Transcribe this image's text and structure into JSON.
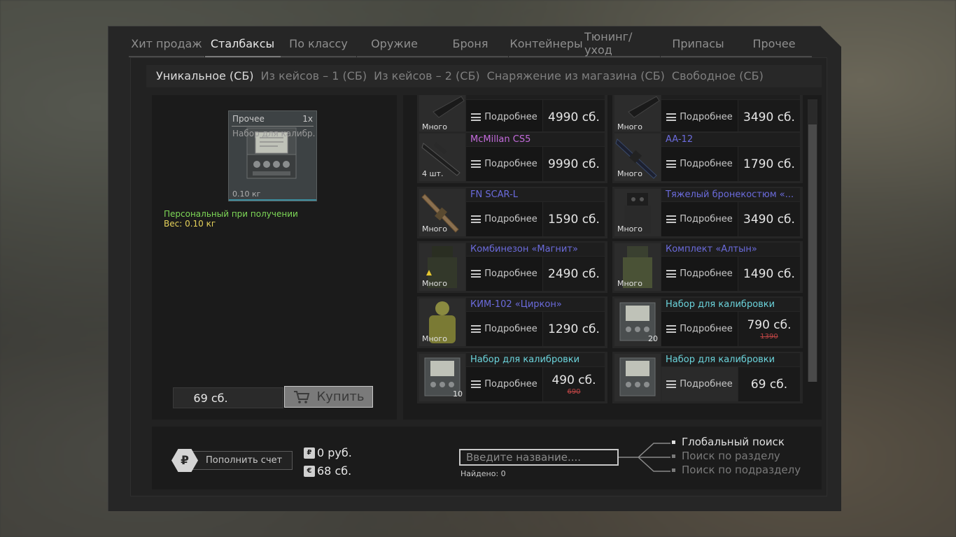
{
  "tabs": [
    "Хит продаж",
    "Сталбаксы",
    "По классу",
    "Оружие",
    "Броня",
    "Контейнеры",
    "Тюнинг/уход",
    "Припасы",
    "Прочее"
  ],
  "active_tab": 1,
  "subtabs": [
    "Уникальное (СБ)",
    "Из кейсов – 1 (СБ)",
    "Из кейсов – 2 (СБ)",
    "Снаряжение из магазина (СБ)",
    "Свободное (СБ)"
  ],
  "active_subtab": 0,
  "preview": {
    "category": "Прочее",
    "quantity": "1x",
    "name": "Набор для калибр...",
    "weight": "0.10 кг",
    "personal_text": "Персональный при получении",
    "weight_text": "Вес: 0.10 кг"
  },
  "purchase": {
    "price": "69 сб.",
    "buy_label": "Купить"
  },
  "details_label": "Подробнее",
  "items": [
    {
      "name": "",
      "color": "#9a6bdc",
      "badge": "Много",
      "price": "4990 сб.",
      "old_price": ""
    },
    {
      "name": "",
      "color": "#6b6bdc",
      "badge": "Много",
      "price": "3490 сб.",
      "old_price": ""
    },
    {
      "name": "McMillan CS5",
      "color": "#c46bdc",
      "badge": "4 шт.",
      "price": "9990 сб.",
      "old_price": ""
    },
    {
      "name": "AA-12",
      "color": "#6b6bdc",
      "badge": "Много",
      "price": "1790 сб.",
      "old_price": ""
    },
    {
      "name": "FN SCAR-L",
      "color": "#6b6bdc",
      "badge": "Много",
      "price": "1590 сб.",
      "old_price": ""
    },
    {
      "name": "Тяжелый бронекостюм «...",
      "color": "#6b6bdc",
      "badge": "Много",
      "price": "3490 сб.",
      "old_price": ""
    },
    {
      "name": "Комбинезон «Магнит»",
      "color": "#6b6bdc",
      "badge": "Много",
      "price": "2490 сб.",
      "old_price": ""
    },
    {
      "name": "Комплект «Алтын»",
      "color": "#6b6bdc",
      "badge": "Много",
      "price": "1490 сб.",
      "old_price": ""
    },
    {
      "name": "КИМ-102 «Циркон»",
      "color": "#6b6bdc",
      "badge": "Много",
      "price": "1290 сб.",
      "old_price": ""
    },
    {
      "name": "Набор для калибровки",
      "color": "#6bd4dc",
      "badge": "20",
      "price": "790 сб.",
      "old_price": "1390"
    },
    {
      "name": "Набор для калибровки",
      "color": "#6bd4dc",
      "badge": "10",
      "price": "490 сб.",
      "old_price": "690"
    },
    {
      "name": "Набор для калибровки",
      "color": "#6bd4dc",
      "badge": "",
      "price": "69 сб.",
      "old_price": ""
    }
  ],
  "account": {
    "topup_label": "Пополнить счет",
    "topup_icon": "₽",
    "rub_icon": "₽",
    "rub_balance": "0 руб.",
    "sb_icon": "€",
    "sb_balance": "68 сб."
  },
  "search": {
    "placeholder": "Введите название....",
    "found": "Найдено: 0",
    "options": [
      "Глобальный поиск",
      "Поиск по разделу",
      "Поиск по подразделу"
    ],
    "active_option": 0
  }
}
